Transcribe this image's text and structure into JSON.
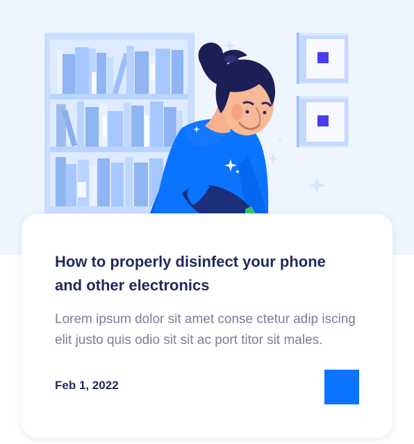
{
  "article": {
    "title": "How to properly disinfect your phone and other electronics",
    "excerpt": "Lorem ipsum dolor sit amet conse ctetur adip iscing elit justo quis odio sit sit ac port titor sit males.",
    "date": "Feb 1, 2022"
  },
  "illustration": {
    "icon": "person-at-bookshelf-illustration",
    "colors": {
      "background": "#eef5ff",
      "shelf": "#b8d4ff",
      "accent": "#0a74ff",
      "hair": "#1c1f55",
      "frame_square": "#4b3cf0"
    }
  },
  "action": {
    "icon": "blue-square-button"
  },
  "colors": {
    "title": "#1f2a5c",
    "excerpt": "#777e98",
    "button": "#0a74ff"
  }
}
